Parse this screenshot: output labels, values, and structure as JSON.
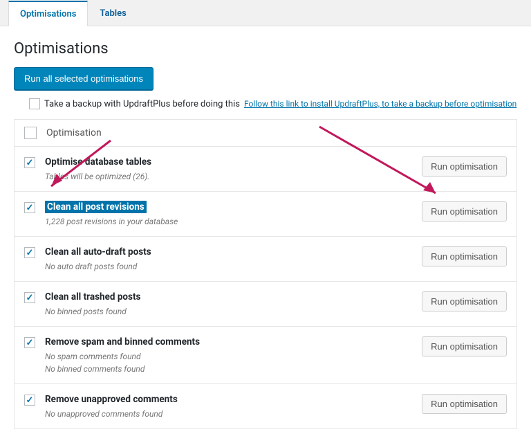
{
  "tabs": {
    "optimisations": "Optimisations",
    "tables": "Tables"
  },
  "heading": "Optimisations",
  "run_all_label": "Run all selected optimisations",
  "backup": {
    "label": "Take a backup with UpdraftPlus before doing this",
    "link": "Follow this link to install UpdraftPlus, to take a backup before optimisation"
  },
  "table_header": "Optimisation",
  "run_label": "Run optimisation",
  "rows": [
    {
      "title": "Optimise database tables",
      "desc": [
        "Tables will be optimized (26)."
      ]
    },
    {
      "title": "Clean all post revisions",
      "desc": [
        "1,228 post revisions in your database"
      ],
      "highlight": true
    },
    {
      "title": "Clean all auto-draft posts",
      "desc": [
        "No auto draft posts found"
      ]
    },
    {
      "title": "Clean all trashed posts",
      "desc": [
        "No binned posts found"
      ]
    },
    {
      "title": "Remove spam and binned comments",
      "desc": [
        "No spam comments found",
        "No binned comments found"
      ]
    },
    {
      "title": "Remove unapproved comments",
      "desc": [
        "No unapproved comments found"
      ]
    }
  ]
}
